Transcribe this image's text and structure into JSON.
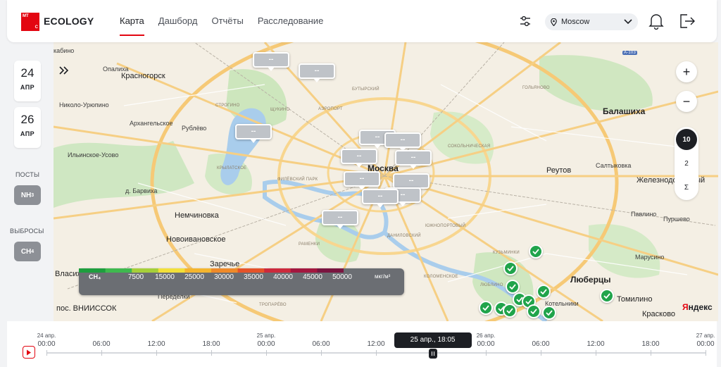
{
  "header": {
    "logo_top": "МТ",
    "logo_bottom": "С",
    "brand": "ECOLOGY",
    "tabs": [
      {
        "label": "Карта",
        "active": true
      },
      {
        "label": "Дашборд",
        "active": false
      },
      {
        "label": "Отчёты",
        "active": false
      },
      {
        "label": "Расследование",
        "active": false
      }
    ],
    "city": "Moscow",
    "icons": [
      "filters-icon",
      "location-pin-icon",
      "chevron-down-icon",
      "bell-icon",
      "logout-icon"
    ],
    "accent_color": "#e30611"
  },
  "sidebar": {
    "date_from": {
      "day": "24",
      "month": "АПР"
    },
    "date_to": {
      "day": "26",
      "month": "АПР"
    },
    "posts_label": "ПОСТЫ",
    "posts_chip": "NH",
    "posts_chip_sub": "3",
    "emissions_label": "ВЫБРОСЫ",
    "emissions_chip": "CH",
    "emissions_chip_sub": "4"
  },
  "map": {
    "labels": {
      "kabino": "кабино",
      "krasnogorsk": "Красногорск",
      "opaliha": "Опалиха",
      "nikolo_uryupino": "Николо-Урюпино",
      "arkhangelskoe": "Архангельское",
      "rublevo": "Рублёво",
      "ilinskoe": "Ильинское-Усово",
      "barviha": "д. Барвиха",
      "nemchinovka": "Немчиновка",
      "novoivankovo": "Новоивановское",
      "zarechye": "Заречье",
      "vlasikha": "Власиха",
      "peredelki": "Переделки",
      "vniissok": "пос. ВНИИССОК",
      "moskva": "Москва",
      "balashiha": "Балашиха",
      "reutov": "Реутов",
      "saltykovka": "Салтыковка",
      "zheleznodorozhny": "Железнодорожный",
      "pavlino": "Павлино",
      "purshevo": "Пуршево",
      "marusino": "Марусино",
      "lyubertsy": "Люберцы",
      "tomilino": "Томилино",
      "kraskovo": "Красково",
      "kotelniki": "Котельники",
      "golyanovo": "ГОЛЬЯНОВО",
      "butyrsky": "БУТЫРСКИЙ",
      "aeroport": "АЭРОПОРТ",
      "shchukino": "ЩУКИНО",
      "strogino": "СТРОГИНО",
      "krylatskoe": "КРЫЛАТСКОЕ",
      "filevsky": "ФИЛЁВСКИЙ ПАРК",
      "ramenki": "РАМЕНКИ",
      "danilovsky": "ДАНИЛОВСКИЙ",
      "yuzhnoportovy": "ЮЖНОПОРТОВЫЙ",
      "kuzminki": "КУЗЬМИНКИ",
      "lyublino": "ЛЮБЛИНО",
      "troparevo": "ТРОПАРЁВО",
      "sokolnicheskaya": "СОКОЛЬНИЧЕСКАЯ",
      "kolomenskoe": "КОЛОМЕНСКОЕ",
      "a103": "А-103",
      "yandex_red": "Я",
      "yandex_black": "ндекс"
    },
    "bubble_text": "--",
    "zoom_in": "+",
    "zoom_out": "−",
    "levels": [
      "10",
      "2",
      "Σ"
    ],
    "active_level": "10"
  },
  "legend": {
    "gas": "CH₄",
    "ticks": [
      "7500",
      "15000",
      "25000",
      "30000",
      "35000",
      "40000",
      "45000",
      "50000"
    ],
    "unit": "мкг/м³",
    "colors": [
      "#1e9e3e",
      "#3fb94f",
      "#a6cf3a",
      "#f2e03a",
      "#f4b52e",
      "#ef8a29",
      "#e5532a",
      "#cc2a3c",
      "#a3173f",
      "#7a1540"
    ]
  },
  "timeline": {
    "days": [
      {
        "label": "24 апр.",
        "pos": 0.0
      },
      {
        "label": "25 апр.",
        "pos": 0.3333
      },
      {
        "label": "26 апр.",
        "pos": 0.6667
      },
      {
        "label": "27 апр.",
        "pos": 1.0
      }
    ],
    "ticks": [
      "00:00",
      "06:00",
      "12:00",
      "18:00",
      "00:00",
      "06:00",
      "12:00",
      "18:00",
      "00:00",
      "06:00",
      "12:00",
      "18:00",
      "00:00"
    ],
    "current": "25 апр., 18:05",
    "current_fraction": 0.5861
  }
}
